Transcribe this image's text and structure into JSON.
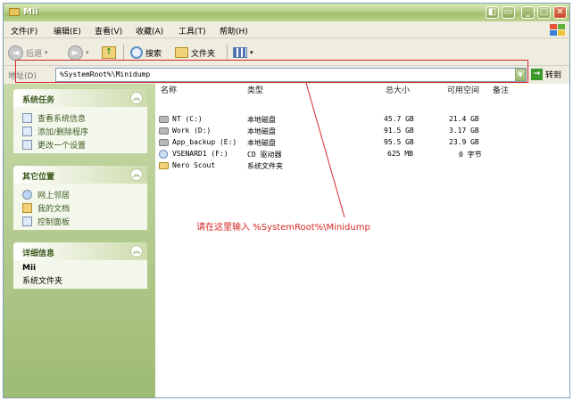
{
  "window": {
    "title": "Mii"
  },
  "menu": [
    "文件(F)",
    "编辑(E)",
    "查看(V)",
    "收藏(A)",
    "工具(T)",
    "帮助(H)"
  ],
  "toolbar": {
    "back": "后退",
    "search": "搜索",
    "folders": "文件夹"
  },
  "address": {
    "label": "地址(D)",
    "value": "%SystemRoot%\\Minidump",
    "go": "转到"
  },
  "sidebar": {
    "tasks": {
      "title": "系统任务",
      "items": [
        "查看系统信息",
        "添加/删除程序",
        "更改一个设置"
      ]
    },
    "places": {
      "title": "其它位置",
      "items": [
        "网上邻居",
        "我的文档",
        "控制面板"
      ]
    },
    "details": {
      "title": "详细信息",
      "name": "Mii",
      "desc": "系统文件夹"
    }
  },
  "columns": {
    "name": "名称",
    "type": "类型",
    "total": "总大小",
    "free": "可用空间",
    "note": "备注"
  },
  "rows": [
    {
      "name": "NT (C:)",
      "type": "本地磁盘",
      "total": "45.7 GB",
      "free": "21.4 GB",
      "icon": "drive-icon"
    },
    {
      "name": "Work (D:)",
      "type": "本地磁盘",
      "total": "91.5 GB",
      "free": "3.17 GB",
      "icon": "drive-icon"
    },
    {
      "name": "App_backup (E:)",
      "type": "本地磁盘",
      "total": "95.5 GB",
      "free": "23.9 GB",
      "icon": "drive-icon"
    },
    {
      "name": "VSENARD1 (F:)",
      "type": "CD 驱动器",
      "total": "625 MB",
      "free": "0 字节",
      "icon": "cd-drive-icon"
    },
    {
      "name": "Nero Scout",
      "type": "系统文件夹",
      "total": "",
      "free": "",
      "icon": "folder-icon"
    }
  ],
  "annotation": "请在这里输入 %SystemRoot%\\Minidump",
  "colors": {
    "annotation": "#d62828",
    "title_bar": "#a3bf6f",
    "sidebar": "#c8d9a8"
  }
}
